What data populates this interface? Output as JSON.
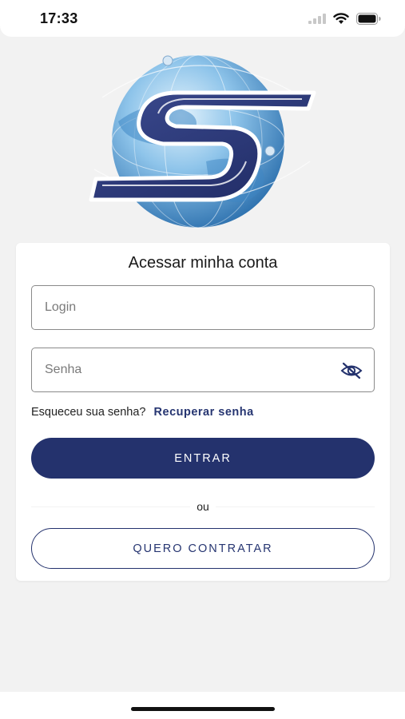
{
  "status_bar": {
    "time": "17:33",
    "icons": [
      "signal-icon",
      "wifi-icon",
      "battery-icon"
    ]
  },
  "logo": {
    "icon": "globe-s-logo"
  },
  "login_card": {
    "title": "Acessar minha conta",
    "login_field": {
      "placeholder": "Login",
      "value": ""
    },
    "password_field": {
      "placeholder": "Senha",
      "value": "",
      "toggle_icon": "eye-off-icon"
    },
    "forgot_text": "Esqueceu sua senha?",
    "recover_link": "Recuperar senha",
    "submit_label": "ENTRAR",
    "divider_text": "ou",
    "signup_label": "QUERO CONTRATAR"
  },
  "colors": {
    "primary": "#24326d",
    "background": "#f2f2f2",
    "card": "#ffffff"
  }
}
